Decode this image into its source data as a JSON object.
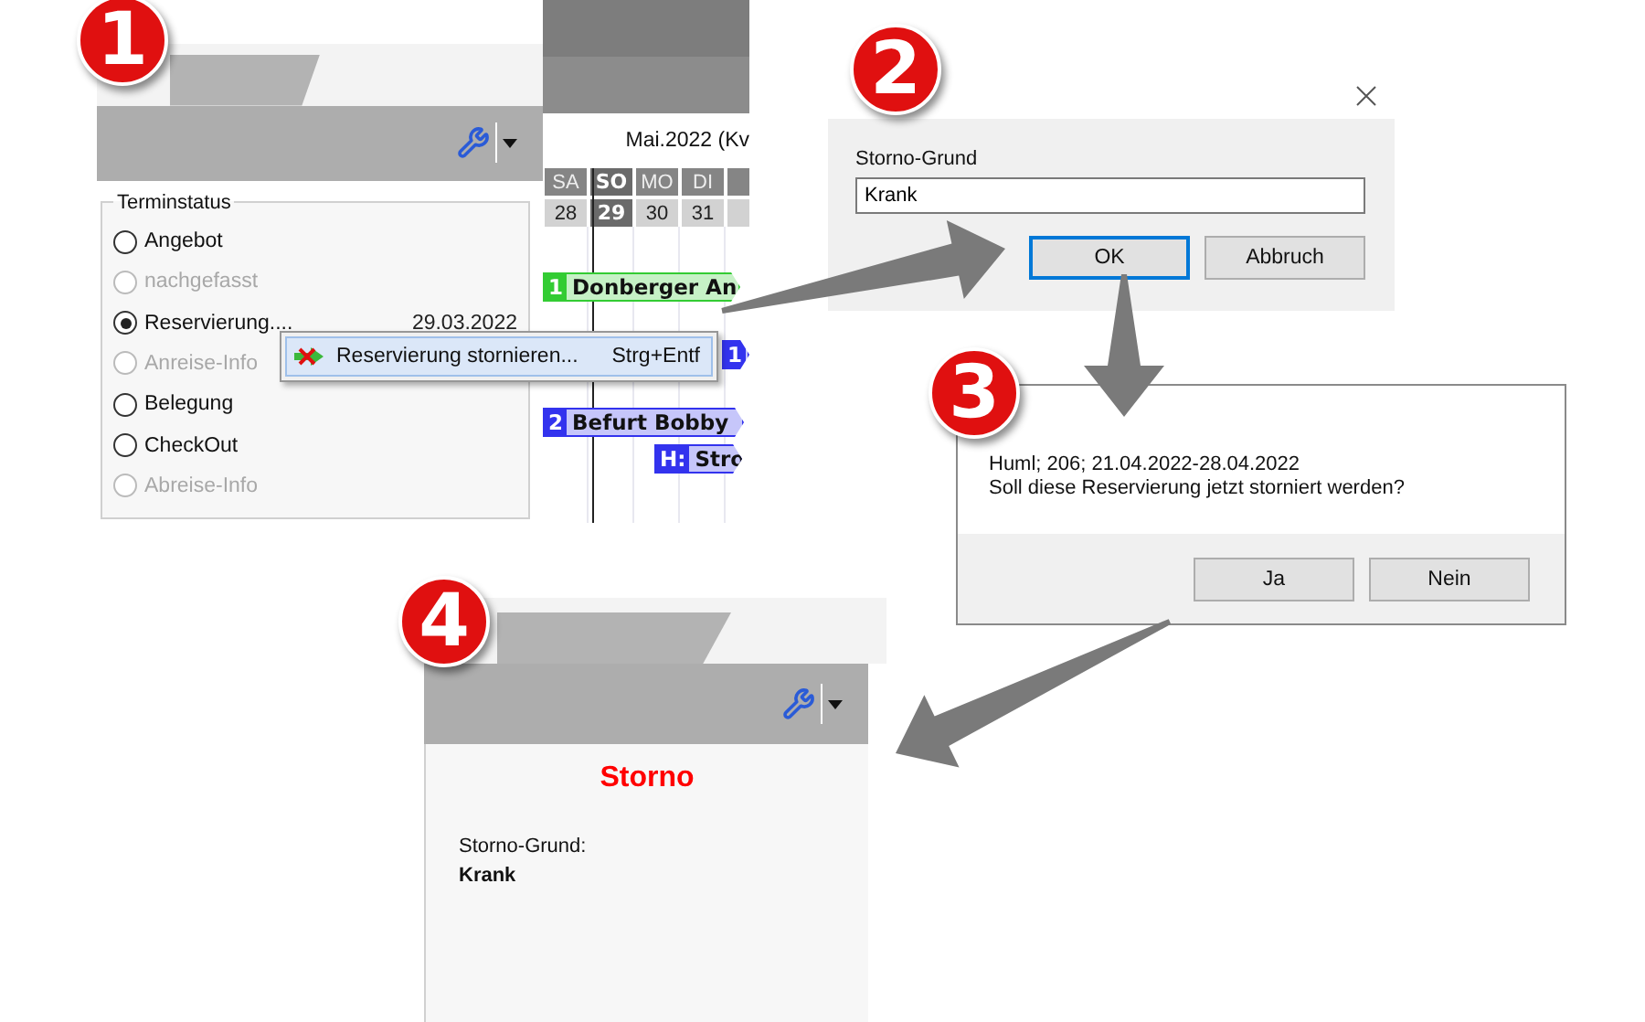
{
  "badges": [
    {
      "number": "1"
    },
    {
      "number": "2"
    },
    {
      "number": "3"
    },
    {
      "number": "4"
    }
  ],
  "status_panel": {
    "group_title": "Terminstatus",
    "options": [
      {
        "label": "Angebot",
        "selected": false,
        "disabled": false
      },
      {
        "label": "nachgefasst",
        "selected": false,
        "disabled": true
      },
      {
        "label": "Reservierung....",
        "selected": true,
        "disabled": false,
        "date": "29.03.2022"
      },
      {
        "label": "Anreise-Info",
        "selected": false,
        "disabled": true
      },
      {
        "label": "Belegung",
        "selected": false,
        "disabled": false
      },
      {
        "label": "CheckOut",
        "selected": false,
        "disabled": false
      },
      {
        "label": "Abreise-Info",
        "selected": false,
        "disabled": true
      }
    ]
  },
  "calendar": {
    "month": "Mai.2022 (Kv",
    "days": [
      {
        "weekday": "SA",
        "date": "28",
        "highlighted": false
      },
      {
        "weekday": "SO",
        "date": "29",
        "highlighted": true
      },
      {
        "weekday": "MO",
        "date": "30",
        "highlighted": false
      },
      {
        "weekday": "DI",
        "date": "31",
        "highlighted": false
      }
    ],
    "bookings": [
      {
        "tag": "1",
        "name": "Donberger An",
        "color": "#33cc33"
      },
      {
        "tag": "1",
        "color": "#3333ee"
      },
      {
        "tag": "2",
        "name": "Befurt Bobby",
        "color": "#3333ee"
      },
      {
        "tag": "H:",
        "name": "Stro",
        "color": "#3333ee"
      }
    ]
  },
  "context_menu": {
    "items": [
      {
        "label": "Reservierung stornieren...",
        "shortcut": "Strg+Entf",
        "highlighted": true
      }
    ]
  },
  "cancel_dialog": {
    "field_label": "Storno-Grund",
    "value": "Krank",
    "buttons": [
      {
        "label": "OK",
        "default": true
      },
      {
        "label": "Abbruch",
        "default": false
      }
    ]
  },
  "confirm_dialog": {
    "lines": [
      "Huml; 206; 21.04.2022-28.04.2022",
      "Soll diese Reservierung jetzt storniert werden?"
    ],
    "buttons": [
      {
        "label": "Ja",
        "default": false
      },
      {
        "label": "Nein",
        "default": false
      }
    ]
  },
  "result_panel": {
    "status": "Storno",
    "field_label": "Storno-Grund:",
    "value": "Krank"
  }
}
